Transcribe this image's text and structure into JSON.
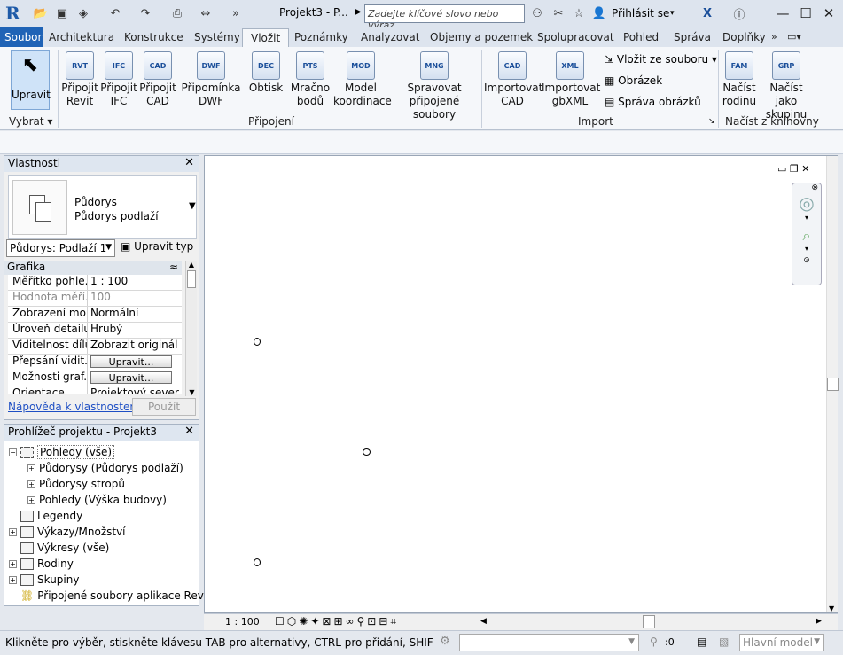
{
  "titlebar": {
    "title": "Projekt3 - P...",
    "search_placeholder": "Zadejte klíčové slovo nebo výraz.",
    "login_label": "Přihlásit se"
  },
  "tabs": [
    "Soubor",
    "Architektura",
    "Konstrukce",
    "Systémy",
    "Vložit",
    "Poznámky",
    "Analyzovat",
    "Objemy a pozemek",
    "Spolupracovat",
    "Pohled",
    "Správa",
    "Doplňky"
  ],
  "active_tab": "Vložit",
  "ribbon": {
    "modify_label": "Upravit",
    "select_label": "Vybrat",
    "link_buttons": [
      {
        "line1": "Připojit",
        "line2": "Revit",
        "icon": "RVT"
      },
      {
        "line1": "Připojit",
        "line2": "IFC",
        "icon": "IFC"
      },
      {
        "line1": "Připojit",
        "line2": "CAD",
        "icon": "CAD"
      },
      {
        "line1": "Připomínka",
        "line2": "DWF",
        "icon": "DWF"
      },
      {
        "line1": "Obtisk",
        "line2": "",
        "icon": "DEC"
      },
      {
        "line1": "Mračno",
        "line2": "bodů",
        "icon": "PTS"
      },
      {
        "line1": "Model",
        "line2": "koordinace",
        "icon": "MOD"
      },
      {
        "line1": "Spravovat",
        "line2": "připojené soubory",
        "icon": "MNG"
      }
    ],
    "link_panel_label": "Připojení",
    "import_buttons": [
      {
        "line1": "Importovat",
        "line2": "CAD",
        "icon": "CAD"
      },
      {
        "line1": "Importovat",
        "line2": "gbXML",
        "icon": "XML"
      }
    ],
    "import_small": [
      "Vložit ze souboru",
      "Obrázek",
      "Správa obrázků"
    ],
    "import_panel_label": "Import",
    "library_buttons": [
      {
        "line1": "Načíst",
        "line2": "rodinu",
        "icon": "FAM"
      },
      {
        "line1": "Načíst jako",
        "line2": "skupinu",
        "icon": "GRP"
      }
    ],
    "library_panel_label": "Načíst z knihovny"
  },
  "properties": {
    "title": "Vlastnosti",
    "type_name": "Půdorys",
    "type_sub": "Půdorys podlaží",
    "instance_select": "Půdorys: Podlaží 1",
    "edit_type": "Upravit typ",
    "group": "Grafika",
    "rows": [
      {
        "k": "Měřítko pohle...",
        "v": "1 : 100"
      },
      {
        "k": "Hodnota měří...",
        "v": "100"
      },
      {
        "k": "Zobrazení mo...",
        "v": "Normální"
      },
      {
        "k": "Úroveň detailu",
        "v": "Hrubý"
      },
      {
        "k": "Viditelnost dílů",
        "v": "Zobrazit originál"
      },
      {
        "k": "Přepsání vidit...",
        "v": "Upravit..."
      },
      {
        "k": "Možnosti graf...",
        "v": "Upravit..."
      },
      {
        "k": "Orientace",
        "v": "Projektový sever"
      }
    ],
    "help_link": "Nápověda k vlastnostem",
    "apply": "Použít"
  },
  "browser": {
    "title": "Prohlížeč projektu - Projekt3",
    "items": [
      {
        "label": "Pohledy (vše)",
        "level": 0,
        "exp": "−"
      },
      {
        "label": "Půdorysy (Půdorys podlaží)",
        "level": 1,
        "exp": "+"
      },
      {
        "label": "Půdorysy stropů",
        "level": 1,
        "exp": "+"
      },
      {
        "label": "Pohledy (Výška budovy)",
        "level": 1,
        "exp": "+"
      },
      {
        "label": "Legendy",
        "level": 0,
        "exp": ""
      },
      {
        "label": "Výkazy/Množství",
        "level": 0,
        "exp": "+"
      },
      {
        "label": "Výkresy (vše)",
        "level": 0,
        "exp": ""
      },
      {
        "label": "Rodiny",
        "level": 0,
        "exp": "+"
      },
      {
        "label": "Skupiny",
        "level": 0,
        "exp": "+"
      },
      {
        "label": "Připojené soubory aplikace Revit",
        "level": 0,
        "exp": ""
      }
    ]
  },
  "viewbar": {
    "scale": "1 : 100"
  },
  "status": {
    "text": "Klikněte pro výběr, stiskněte klávesu TAB pro alternativy, CTRL pro přidání, SHIFT pro odebrání.",
    "count": ":0",
    "model": "Hlavní model"
  }
}
